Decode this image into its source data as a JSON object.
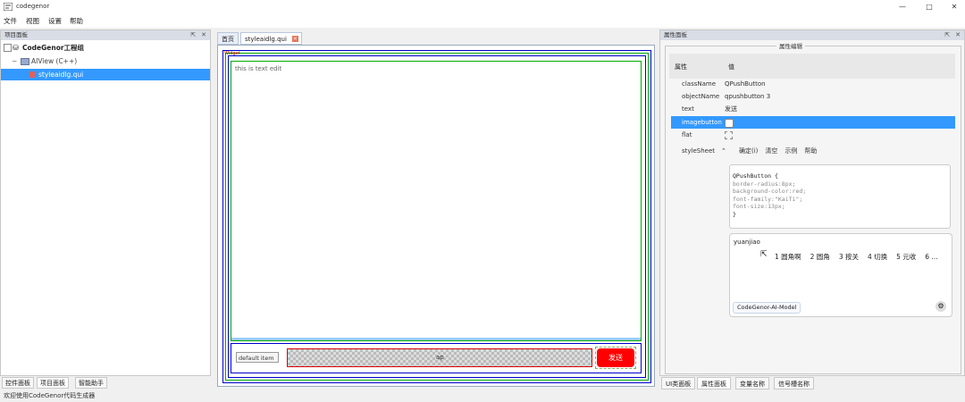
{
  "window": {
    "title": "codegenor",
    "minimize": "—",
    "maximize": "□",
    "close": "✕"
  },
  "menu": [
    "文件",
    "视图",
    "设置",
    "帮助"
  ],
  "left_panel": {
    "title": "项目面板",
    "tree": {
      "root": "CodeGenor工程组",
      "child": "AIView (C++)",
      "file": "styleaidlg.qui"
    },
    "tabs": [
      "控件面板",
      "项目面板",
      "智能助手"
    ]
  },
  "center": {
    "tabs": [
      "首页",
      "styleaidlg.qui"
    ],
    "widget_label": "Widget",
    "textedit": "this is text edit",
    "combo_value": "default item",
    "lineedit_value": "ap",
    "button_label": "发送"
  },
  "right_panel": {
    "title": "属性面板",
    "group_title": "属性编辑",
    "header": {
      "key": "属性",
      "value": "值"
    },
    "props": [
      {
        "key": "className",
        "value": "QPushButton"
      },
      {
        "key": "objectName",
        "value": "qpushbutton 3"
      },
      {
        "key": "text",
        "value": "发送"
      },
      {
        "key": "imagebutton",
        "value": ""
      },
      {
        "key": "flat",
        "value": ""
      },
      {
        "key": "styleSheet",
        "value": ""
      }
    ],
    "stylesheet_buttons": [
      "确定(i)",
      "清空",
      "示例",
      "帮助"
    ],
    "stylesheet_code": [
      "QPushButton {",
      "  border-radius:8px;",
      "  background-color:red;",
      "  font-family:\"KaiTi\";",
      "  font-size:13px;",
      "}"
    ],
    "ai": {
      "text": "yuanjiao",
      "suggestions": [
        "1 圆角啊",
        "2 圆角",
        "3 按关",
        "4 切换",
        "5 元收",
        "6 ..."
      ],
      "model": "CodeGenor-AI-Model"
    },
    "tabs": [
      "UI类面板",
      "属性面板",
      "变量名称",
      "信号槽名称"
    ]
  },
  "status": "欢迎使用CodeGenor代码生成器",
  "colors": {
    "accent": "#3399ff",
    "button_red": "#ff0000",
    "panel_header": "#d8dde6"
  }
}
